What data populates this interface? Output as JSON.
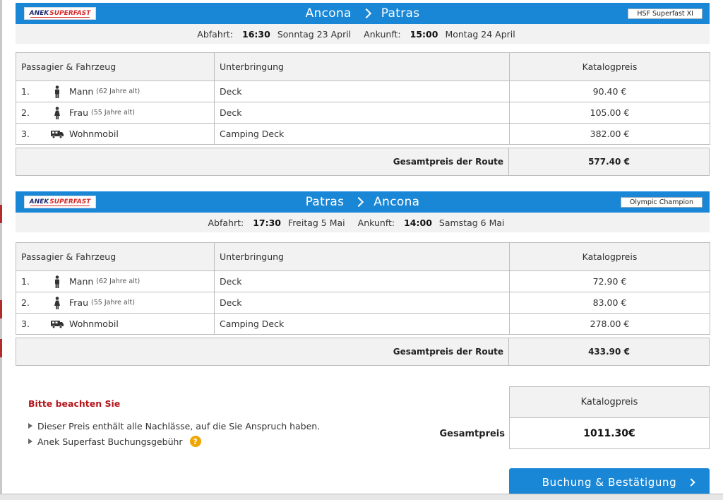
{
  "brand": {
    "logo_a": "ANEK",
    "logo_b": "SUPERFAST"
  },
  "routes": [
    {
      "from": "Ancona",
      "to": "Patras",
      "ship": "HSF Superfast XI",
      "departure_label": "Abfahrt:",
      "departure_time": "16:30",
      "departure_date": "Sonntag 23 April",
      "arrival_label": "Ankunft:",
      "arrival_time": "15:00",
      "arrival_date": "Montag 24 April",
      "columns": [
        "Passagier & Fahrzeug",
        "Unterbringung",
        "Katalogpreis"
      ],
      "rows": [
        {
          "no": "1.",
          "icon": "male-person-icon",
          "name": "Mann",
          "age": "(62 Jahre alt)",
          "accommodation": "Deck",
          "price": "90.40 €"
        },
        {
          "no": "2.",
          "icon": "female-person-icon",
          "name": "Frau",
          "age": "(55 Jahre alt)",
          "accommodation": "Deck",
          "price": "105.00 €"
        },
        {
          "no": "3.",
          "icon": "camper-van-icon",
          "name": "Wohnmobil",
          "age": "",
          "accommodation": "Camping Deck",
          "price": "382.00 €"
        }
      ],
      "total_label": "Gesamtpreis der Route",
      "total_value": "577.40 €"
    },
    {
      "from": "Patras",
      "to": "Ancona",
      "ship": "Olympic Champion",
      "departure_label": "Abfahrt:",
      "departure_time": "17:30",
      "departure_date": "Freitag 5 Mai",
      "arrival_label": "Ankunft:",
      "arrival_time": "14:00",
      "arrival_date": "Samstag 6 Mai",
      "columns": [
        "Passagier & Fahrzeug",
        "Unterbringung",
        "Katalogpreis"
      ],
      "rows": [
        {
          "no": "1.",
          "icon": "male-person-icon",
          "name": "Mann",
          "age": "(62 Jahre alt)",
          "accommodation": "Deck",
          "price": "72.90 €"
        },
        {
          "no": "2.",
          "icon": "female-person-icon",
          "name": "Frau",
          "age": "(55 Jahre alt)",
          "accommodation": "Deck",
          "price": "83.00 €"
        },
        {
          "no": "3.",
          "icon": "camper-van-icon",
          "name": "Wohnmobil",
          "age": "",
          "accommodation": "Camping Deck",
          "price": "278.00 €"
        }
      ],
      "total_label": "Gesamtpreis der Route",
      "total_value": "433.90 €"
    }
  ],
  "notes": {
    "title": "Bitte beachten Sie",
    "items": [
      "Dieser Preis enthält alle Nachlässe, auf die Sie Anspruch haben.",
      "Anek Superfast Buchungsgebühr"
    ],
    "help_icon": "?"
  },
  "summary": {
    "label": "Gesamtpreis",
    "header": "Katalogpreis",
    "value": "1011.30€"
  },
  "book_button": {
    "label": "Buchung & Bestätigung"
  },
  "colors": {
    "accent": "#1a87d6",
    "note_title": "#b4161b",
    "help": "#f0a500"
  }
}
